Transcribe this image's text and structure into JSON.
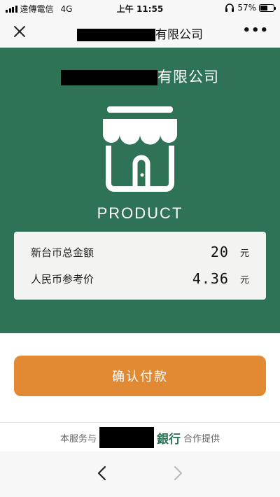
{
  "status_bar": {
    "carrier": "遠傳電信",
    "network": "4G",
    "time": "上午 11:55",
    "battery_percent": "57%",
    "battery_level": 0.57
  },
  "nav": {
    "title_suffix": "有限公司",
    "more_label": "•••",
    "close_icon": "close-icon"
  },
  "merchant": {
    "name_suffix": "有限公司",
    "product_label": "PRODUCT",
    "icon": "storefront-icon"
  },
  "amounts": [
    {
      "label": "新台币总金额",
      "value": "20",
      "currency": "元"
    },
    {
      "label": "人民币参考价",
      "value": "4.36",
      "currency": "元"
    }
  ],
  "confirm_button": {
    "label": "确认付款"
  },
  "footer": {
    "prefix": "本服务与",
    "bank": "銀行",
    "suffix": "合作提供"
  },
  "colors": {
    "brand_green": "#2f7357",
    "button_orange": "#e28a33"
  }
}
